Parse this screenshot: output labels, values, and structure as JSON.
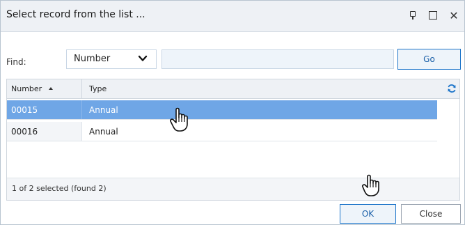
{
  "window": {
    "title": "Select record from the list ...",
    "pin_icon": "pin-icon",
    "maximize_icon": "maximize-icon",
    "close_icon": "close-icon",
    "close_glyph": "✕"
  },
  "find": {
    "label": "Find:",
    "field_select_value": "Number",
    "search_value": "",
    "go_label": "Go"
  },
  "grid": {
    "columns": [
      {
        "label": "Number",
        "sort": "ascending"
      },
      {
        "label": "Type"
      }
    ],
    "rows": [
      {
        "number": "00015",
        "type": "Annual",
        "selected": true
      },
      {
        "number": "00016",
        "type": "Annual",
        "selected": false
      }
    ],
    "refresh_icon": "refresh-icon",
    "status": "1 of 2 selected (found 2)"
  },
  "actions": {
    "ok_label": "OK",
    "close_label": "Close"
  },
  "colors": {
    "selected_row": "#6fa6e6",
    "accent": "#1a73c9",
    "title_bar": "#eef1f5"
  }
}
